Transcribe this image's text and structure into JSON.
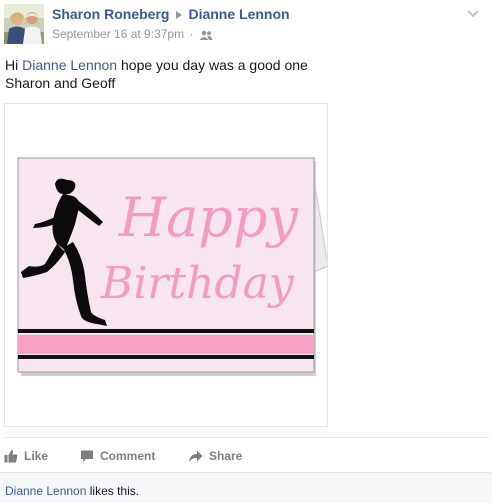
{
  "post": {
    "author": "Sharon Roneberg",
    "target": "Dianne Lennon",
    "timestamp": "September 16 at 9:37pm",
    "separator": "·",
    "audience_icon": "friends-icon",
    "message": {
      "greeting": "Hi",
      "mention": "Dianne Lennon",
      "line1_rest": "hope you day was a good one",
      "line2": "Sharon and Geoff"
    },
    "card": {
      "word1": "Happy",
      "word2": "Birthday",
      "card_color": "#f7e6ef",
      "stripe_color": "#f7a1c4",
      "text_color": "#f59ac0",
      "silhouette_color": "#0b0b0b"
    }
  },
  "actions": {
    "like": "Like",
    "comment": "Comment",
    "share": "Share"
  },
  "likes": {
    "liker": "Dianne Lennon",
    "suffix": "likes this."
  },
  "colors": {
    "link": "#3b5998",
    "meta": "#9197a3",
    "action": "#7f7f7f",
    "likes_bg": "#f6f7f9"
  }
}
